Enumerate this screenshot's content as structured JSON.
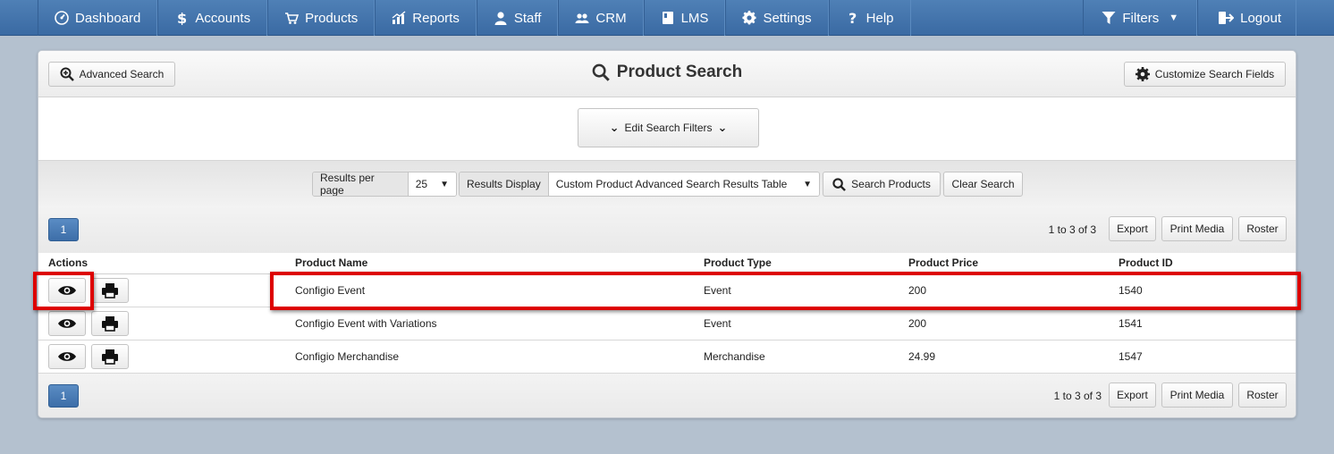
{
  "nav": {
    "left": [
      {
        "label": "Dashboard",
        "icon": "dashboard-icon"
      },
      {
        "label": "Accounts",
        "icon": "dollar-icon"
      },
      {
        "label": "Products",
        "icon": "cart-icon"
      },
      {
        "label": "Reports",
        "icon": "chart-icon"
      },
      {
        "label": "Staff",
        "icon": "user-icon"
      },
      {
        "label": "CRM",
        "icon": "users-icon"
      },
      {
        "label": "LMS",
        "icon": "book-icon"
      },
      {
        "label": "Settings",
        "icon": "gear-icon"
      },
      {
        "label": "Help",
        "icon": "question-icon"
      }
    ],
    "filters_label": "Filters",
    "logout_label": "Logout"
  },
  "header": {
    "advanced_search_label": "Advanced Search",
    "title": "Product Search",
    "customize_label": "Customize Search Fields"
  },
  "filters": {
    "edit_label": "Edit Search Filters"
  },
  "toolbar": {
    "results_per_page_label": "Results per page",
    "results_per_page_value": "25",
    "results_display_label": "Results Display",
    "results_display_value": "Custom Product Advanced Search Results Table",
    "search_label": "Search Products",
    "clear_label": "Clear Search"
  },
  "pager": {
    "page": "1",
    "range_text": "1 to 3 of 3",
    "export_label": "Export",
    "print_media_label": "Print Media",
    "roster_label": "Roster"
  },
  "table": {
    "headers": {
      "actions": "Actions",
      "name": "Product Name",
      "type": "Product Type",
      "price": "Product Price",
      "id": "Product ID"
    },
    "rows": [
      {
        "name": "Configio Event",
        "type": "Event",
        "price": "200",
        "id": "1540"
      },
      {
        "name": "Configio Event with Variations",
        "type": "Event",
        "price": "200",
        "id": "1541"
      },
      {
        "name": "Configio Merchandise",
        "type": "Merchandise",
        "price": "24.99",
        "id": "1547"
      }
    ]
  },
  "colors": {
    "nav_bg": "#3f6fa8",
    "page_bg": "#b4c1cf",
    "highlight": "#dd0000",
    "page_button": "#4a7db8"
  }
}
